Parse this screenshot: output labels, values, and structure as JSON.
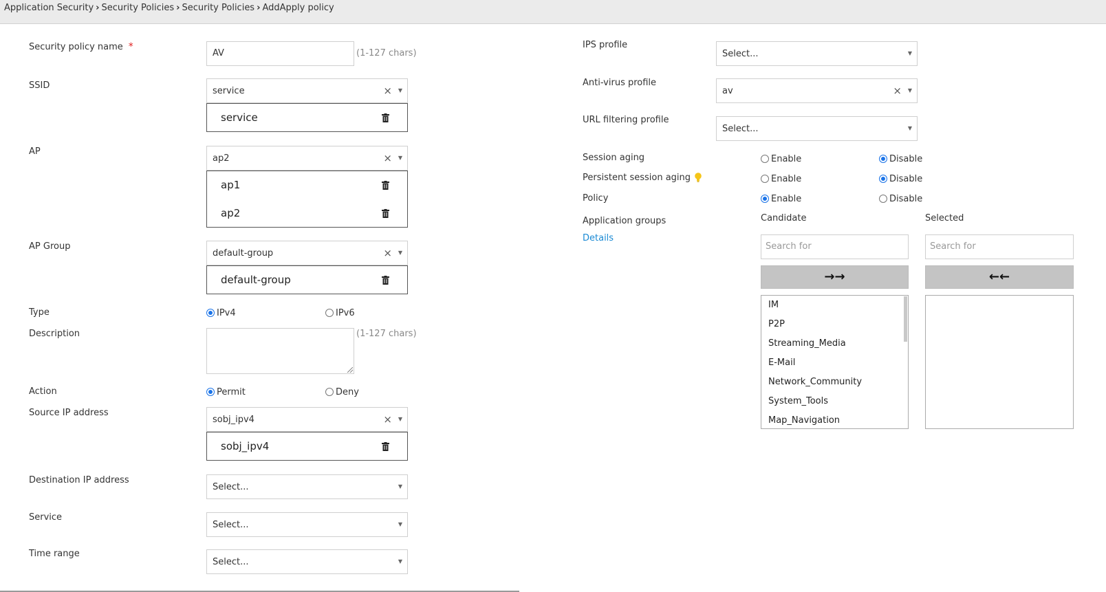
{
  "breadcrumb": [
    "Application Security",
    "Security Policies",
    "Security Policies",
    "AddApply policy"
  ],
  "form": {
    "policy_name": {
      "label": "Security policy name",
      "required_mark": "*",
      "value": "AV",
      "hint": "(1-127 chars)"
    },
    "ssid": {
      "label": "SSID",
      "value": "service",
      "clear": "×",
      "selected": [
        "service"
      ]
    },
    "ap": {
      "label": "AP",
      "value": "ap2",
      "clear": "×",
      "selected": [
        "ap1",
        "ap2"
      ]
    },
    "ap_group": {
      "label": "AP Group",
      "value": "default-group",
      "clear": "×",
      "selected": [
        "default-group"
      ]
    },
    "type": {
      "label": "Type",
      "options": [
        "IPv4",
        "IPv6"
      ],
      "selected": "IPv4"
    },
    "description": {
      "label": "Description",
      "value": "",
      "hint": "(1-127 chars)"
    },
    "action": {
      "label": "Action",
      "options": [
        "Permit",
        "Deny"
      ],
      "selected": "Permit"
    },
    "source_ip": {
      "label": "Source IP address",
      "value": "sobj_ipv4",
      "clear": "×",
      "selected": [
        "sobj_ipv4"
      ]
    },
    "destination_ip": {
      "label": "Destination IP address",
      "placeholder": "Select..."
    },
    "service": {
      "label": "Service",
      "placeholder": "Select..."
    },
    "time_range": {
      "label": "Time range",
      "placeholder": "Select..."
    }
  },
  "right": {
    "ips_profile": {
      "label": "IPS profile",
      "placeholder": "Select..."
    },
    "antivirus_profile": {
      "label": "Anti-virus profile",
      "value": "av",
      "clear": "×"
    },
    "url_filtering_profile": {
      "label": "URL filtering profile",
      "placeholder": "Select..."
    },
    "session_aging": {
      "label": "Session aging",
      "options": [
        "Enable",
        "Disable"
      ],
      "selected": "Disable"
    },
    "persistent_session_aging": {
      "label": "Persistent session aging",
      "options": [
        "Enable",
        "Disable"
      ],
      "selected": "Disable"
    },
    "policy": {
      "label": "Policy",
      "options": [
        "Enable",
        "Disable"
      ],
      "selected": "Enable"
    },
    "application_groups": {
      "label": "Application groups",
      "details_link": "Details",
      "candidate_title": "Candidate",
      "selected_title": "Selected",
      "search_placeholder": "Search for",
      "add_arrow": "→→",
      "remove_arrow": "←←",
      "candidates": [
        "IM",
        "P2P",
        "Streaming_Media",
        "E-Mail",
        "Network_Community",
        "System_Tools",
        "Map_Navigation"
      ],
      "selected_items": []
    }
  },
  "icons": {
    "caret": "caret-down-icon",
    "trash": "trash-icon",
    "bulb": "lightbulb-icon"
  },
  "colors": {
    "accent": "#1a73e8",
    "required": "#e02020",
    "link": "#1a8ad4",
    "bulb": "#f5c518"
  }
}
